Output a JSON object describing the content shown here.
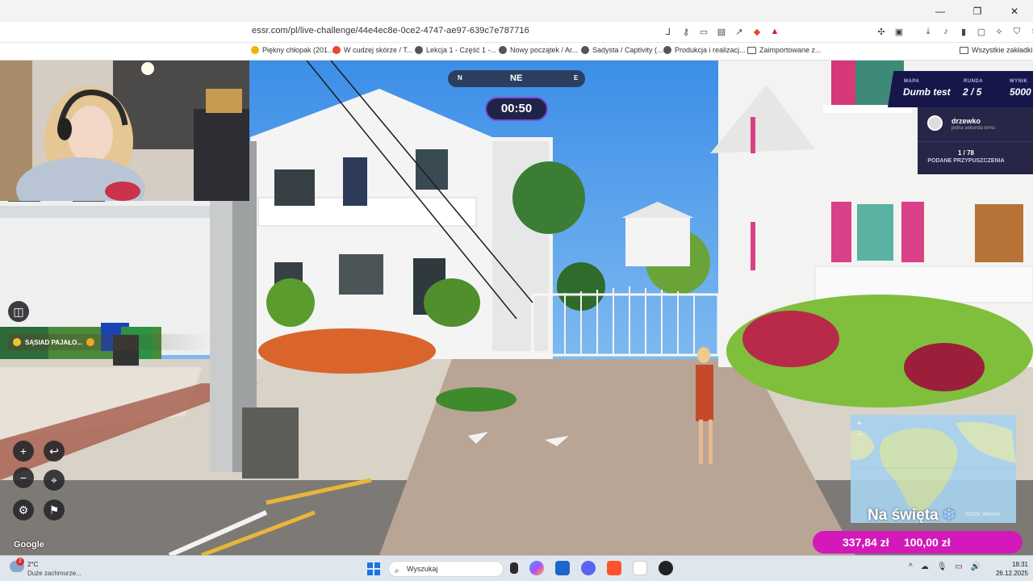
{
  "browser": {
    "url": "essr.com/pl/live-challenge/44e4ec8e-0ce2-4747-ae97-639c7e787716",
    "bookmarks": [
      "Piękny chłopak (201...",
      "W cudzej skórze / T...",
      "Lekcja 1 - Część 1 -...",
      "Nowy początek / Ar...",
      "Sadysta / Captivity (...",
      "Produkcja i realizacj...",
      "Zaimportowane z..."
    ],
    "all_bookmarks": "Wszystkie zakładki",
    "shield_badge": "1"
  },
  "game": {
    "compass": {
      "left": "N",
      "center": "NE",
      "right": "E"
    },
    "timer": "00:50",
    "hud": {
      "map_label": "MAPA",
      "map_value": "Dumb test",
      "round_label": "RUNDA",
      "round_value": "2 / 5",
      "score_label": "WYNIK",
      "score_value": "5000"
    },
    "player": {
      "name": "drzewko",
      "status": "jedna sekunda temu"
    },
    "guesses": {
      "count": "1 / 78",
      "label": "PODANE PRZYPUSZCZENIA"
    },
    "google_logo": "Google",
    "map_credit": "©2025, Warunki"
  },
  "chat": {
    "user": "SĄSIAD PAJAŁO..."
  },
  "stream_overlay": {
    "holiday_text": "Na święta",
    "donation_current": "337,84 zł",
    "donation_goal": "100,00 zł"
  },
  "taskbar": {
    "weather_temp": "2°C",
    "weather_desc": "Duże zachmurze...",
    "weather_badge": "2",
    "search_placeholder": "Wyszukaj",
    "time": "18:31",
    "date": "26.12.2025"
  }
}
